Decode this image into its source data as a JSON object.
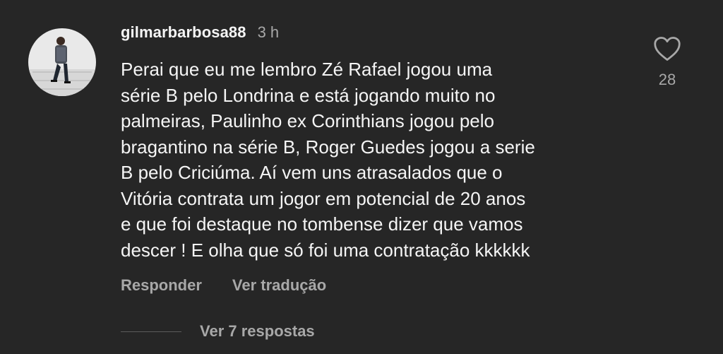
{
  "comment": {
    "username": "gilmarbarbosa88",
    "time": "3 h",
    "text_lines": [
      "Perai que eu me lembro Zé Rafael jogou uma",
      "série B pelo Londrina e está jogando muito no",
      "palmeiras, Paulinho ex Corinthians jogou pelo",
      "bragantino na série B, Roger Guedes jogou a serie",
      "B pelo Criciúma. Aí vem uns atrasalados que o",
      "Vitória contrata um jogor em potencial de 20 anos",
      "e que foi destaque no tombense dizer que vamos",
      "descer ! E olha que só foi uma contratação kkkkkk"
    ],
    "like_count": "28",
    "like_icon": "heart-outline-icon"
  },
  "actions": {
    "reply_label": "Responder",
    "translate_label": "Ver tradução"
  },
  "replies": {
    "view_label": "Ver 7 respostas"
  },
  "colors": {
    "background": "#262626",
    "primary_text": "#f5f5f5",
    "secondary_text": "#a8a8a8"
  }
}
